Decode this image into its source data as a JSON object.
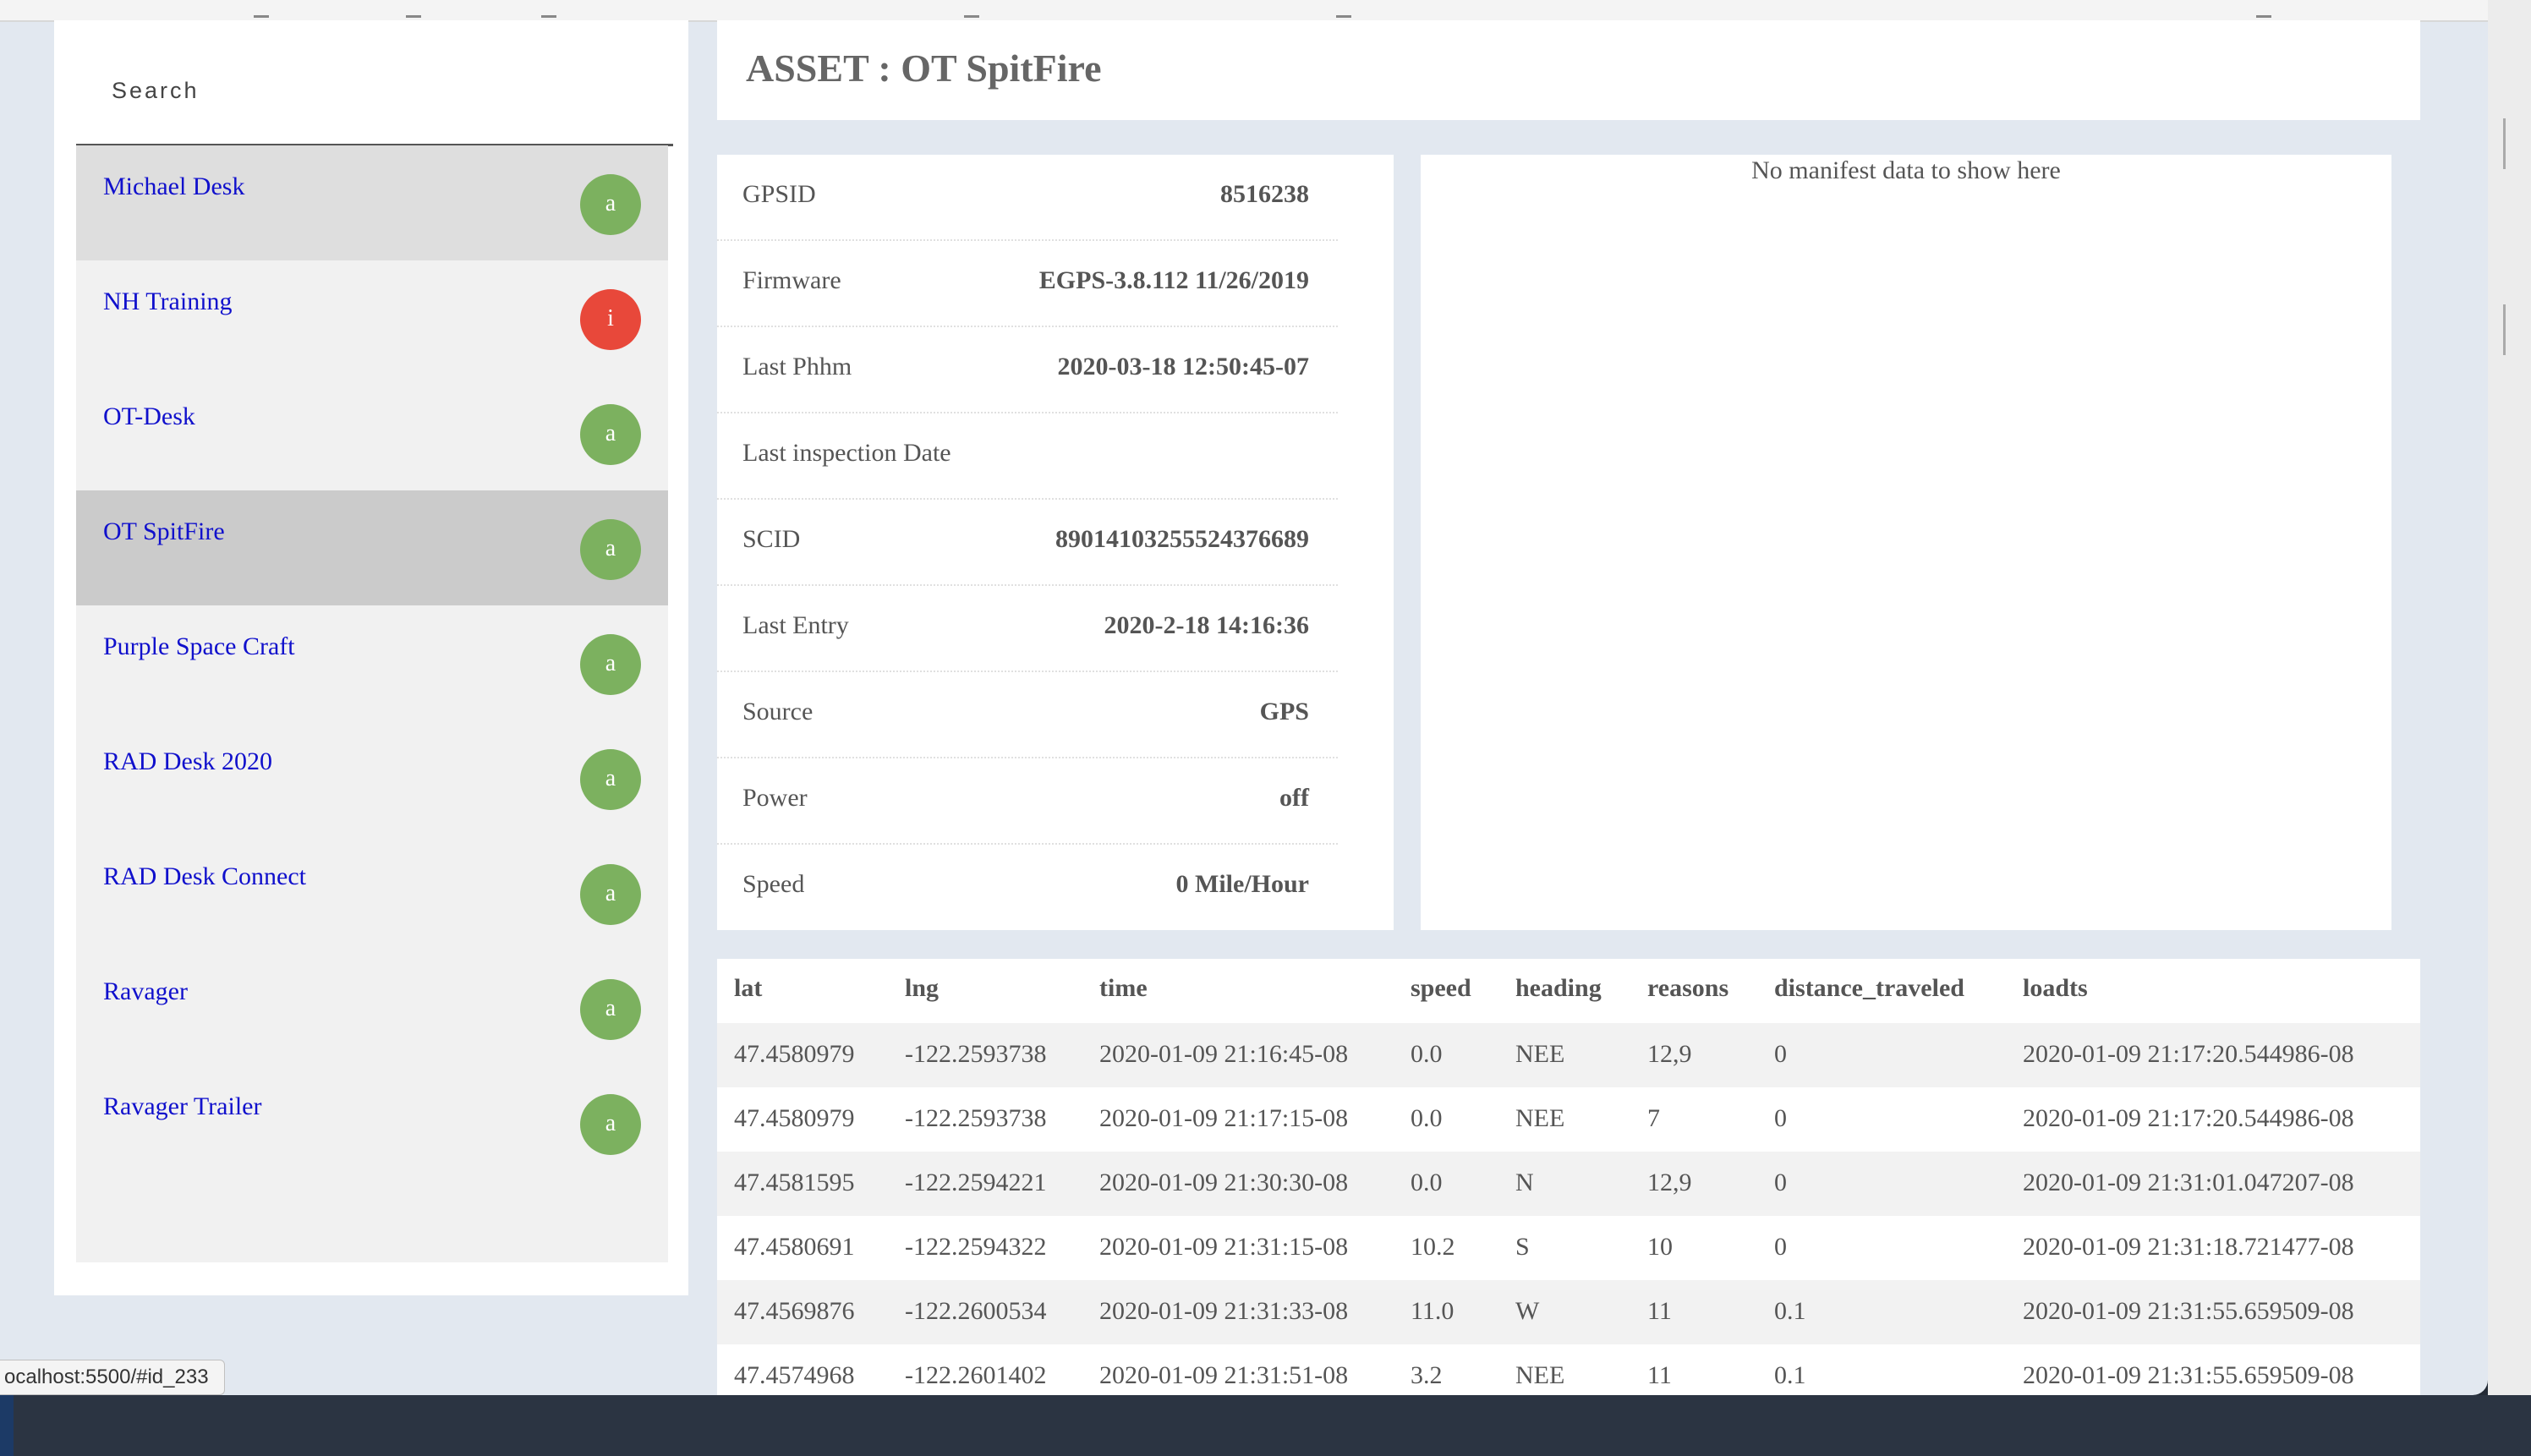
{
  "search": {
    "placeholder": "Search"
  },
  "sidebar": {
    "top_partial_badge": "a",
    "items": [
      {
        "label": "Michael Desk",
        "badge": "a",
        "status": "active"
      },
      {
        "label": "NH Training",
        "badge": "i",
        "status": "inactive"
      },
      {
        "label": "OT-Desk",
        "badge": "a",
        "status": "active"
      },
      {
        "label": "OT SpitFire",
        "badge": "a",
        "status": "active"
      },
      {
        "label": "Purple Space Craft",
        "badge": "a",
        "status": "active"
      },
      {
        "label": "RAD Desk 2020",
        "badge": "a",
        "status": "active"
      },
      {
        "label": "RAD Desk Connect",
        "badge": "a",
        "status": "active"
      },
      {
        "label": "Ravager",
        "badge": "a",
        "status": "active"
      },
      {
        "label": "Ravager Trailer",
        "badge": "a",
        "status": "active"
      }
    ]
  },
  "header": {
    "title": "ASSET : OT SpitFire"
  },
  "details": [
    {
      "key": "GPSID",
      "value": "8516238"
    },
    {
      "key": "Firmware",
      "value": "EGPS-3.8.112 11/26/2019"
    },
    {
      "key": "Last Phhm",
      "value": "2020-03-18 12:50:45-07"
    },
    {
      "key": "Last inspection Date",
      "value": ""
    },
    {
      "key": "SCID",
      "value": "89014103255524376689"
    },
    {
      "key": "Last Entry",
      "value": "2020-2-18 14:16:36"
    },
    {
      "key": "Source",
      "value": "GPS"
    },
    {
      "key": "Power",
      "value": "off"
    },
    {
      "key": "Speed",
      "value": "0 Mile/Hour"
    }
  ],
  "manifest": {
    "empty_message": "No manifest data to show here"
  },
  "table": {
    "columns": [
      "lat",
      "lng",
      "time",
      "speed",
      "heading",
      "reasons",
      "distance_traveled",
      "loadts"
    ],
    "rows": [
      [
        "47.4580979",
        "-122.2593738",
        "2020-01-09 21:16:45-08",
        "0.0",
        "NEE",
        "12,9",
        "0",
        "2020-01-09 21:17:20.544986-08"
      ],
      [
        "47.4580979",
        "-122.2593738",
        "2020-01-09 21:17:15-08",
        "0.0",
        "NEE",
        "7",
        "0",
        "2020-01-09 21:17:20.544986-08"
      ],
      [
        "47.4581595",
        "-122.2594221",
        "2020-01-09 21:30:30-08",
        "0.0",
        "N",
        "12,9",
        "0",
        "2020-01-09 21:31:01.047207-08"
      ],
      [
        "47.4580691",
        "-122.2594322",
        "2020-01-09 21:31:15-08",
        "10.2",
        "S",
        "10",
        "0",
        "2020-01-09 21:31:18.721477-08"
      ],
      [
        "47.4569876",
        "-122.2600534",
        "2020-01-09 21:31:33-08",
        "11.0",
        "W",
        "11",
        "0.1",
        "2020-01-09 21:31:55.659509-08"
      ],
      [
        "47.4574968",
        "-122.2601402",
        "2020-01-09 21:31:51-08",
        "3.2",
        "NEE",
        "11",
        "0.1",
        "2020-01-09 21:31:55.659509-08"
      ]
    ]
  },
  "status_bar": {
    "url": "ocalhost:5500/#id_233"
  },
  "colors": {
    "active_badge": "#7cb15f",
    "inactive_badge": "#e8483a",
    "link": "#1010cc"
  }
}
